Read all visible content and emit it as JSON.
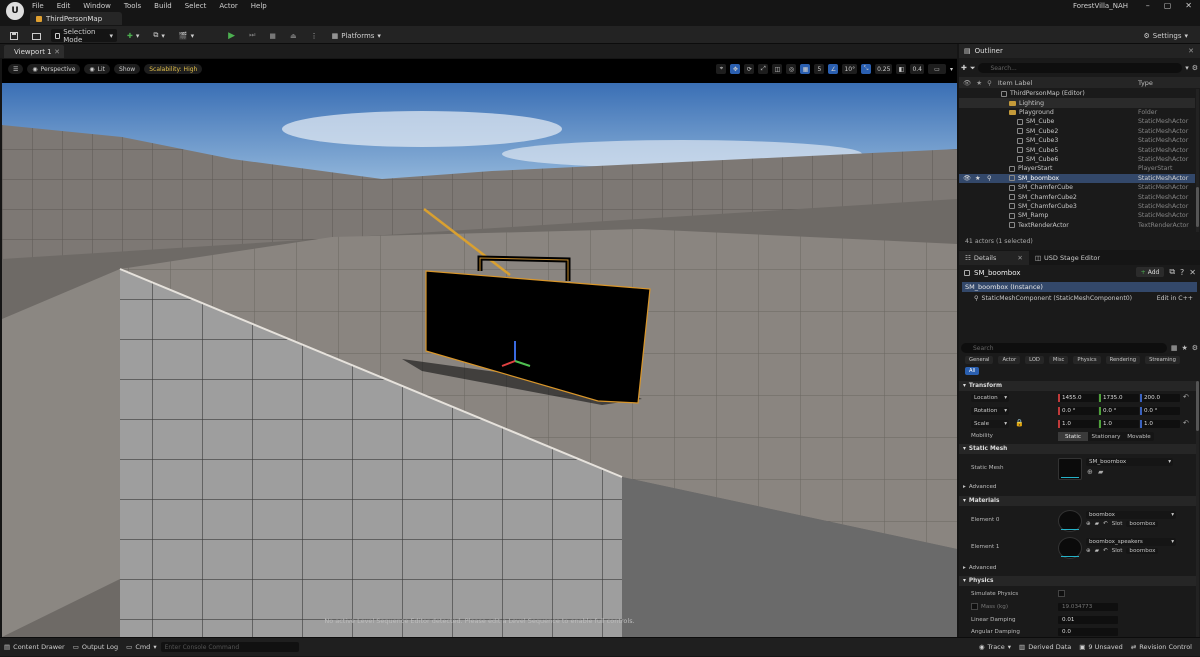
{
  "app": {
    "logo": "U",
    "project": "ForestVilla_NAH",
    "doc_tab": "ThirdPersonMap",
    "menus": [
      "File",
      "Edit",
      "Window",
      "Tools",
      "Build",
      "Select",
      "Actor",
      "Help"
    ],
    "win_min": "–",
    "win_max": "▢",
    "win_close": "✕"
  },
  "toolbar": {
    "selection_mode": "Selection Mode",
    "platforms": "Platforms",
    "settings": "Settings"
  },
  "viewport": {
    "tab_label": "Viewport 1",
    "perspective": "Perspective",
    "lit": "Lit",
    "show": "Show",
    "scalability": "Scalability: High",
    "grid_snap": "5",
    "angle_snap": "10°",
    "scale_snap": "0.25",
    "camera_speed": "0.4",
    "notice": "No active Level Sequence Editor detected. Please edit a Level Sequence to enable full controls."
  },
  "outliner": {
    "title": "Outliner",
    "search_placeholder": "Search...",
    "col_label": "Item Label",
    "col_type": "Type",
    "rows": [
      {
        "label": "ThirdPersonMap (Editor)",
        "type": ""
      },
      {
        "label": "Lighting",
        "type": ""
      },
      {
        "label": "Playground",
        "type": "Folder"
      },
      {
        "label": "SM_Cube",
        "type": "StaticMeshActor"
      },
      {
        "label": "SM_Cube2",
        "type": "StaticMeshActor"
      },
      {
        "label": "SM_Cube3",
        "type": "StaticMeshActor"
      },
      {
        "label": "SM_Cube5",
        "type": "StaticMeshActor"
      },
      {
        "label": "SM_Cube6",
        "type": "StaticMeshActor"
      },
      {
        "label": "PlayerStart",
        "type": "PlayerStart"
      },
      {
        "label": "SM_boombox",
        "type": "StaticMeshActor"
      },
      {
        "label": "SM_ChamferCube",
        "type": "StaticMeshActor"
      },
      {
        "label": "SM_ChamferCube2",
        "type": "StaticMeshActor"
      },
      {
        "label": "SM_ChamferCube3",
        "type": "StaticMeshActor"
      },
      {
        "label": "SM_Ramp",
        "type": "StaticMeshActor"
      },
      {
        "label": "TextRenderActor",
        "type": "TextRenderActor"
      }
    ],
    "count": "41 actors (1 selected)"
  },
  "details": {
    "tab_details": "Details",
    "tab_usd": "USD Stage Editor",
    "actor_name": "SM_boombox",
    "add_label": "Add",
    "instance_label": "SM_boombox (Instance)",
    "component_label": "StaticMeshComponent (StaticMeshComponent0)",
    "edit_cpp": "Edit in C++",
    "search_placeholder": "Search",
    "categories": [
      "General",
      "Actor",
      "LOD",
      "Misc",
      "Physics",
      "Rendering",
      "Streaming"
    ],
    "category_all": "All",
    "transform": {
      "section": "Transform",
      "location_label": "Location",
      "location": [
        "1455.0",
        "1735.0",
        "200.0"
      ],
      "rotation_label": "Rotation",
      "rotation": [
        "0.0 °",
        "0.0 °",
        "0.0 °"
      ],
      "scale_label": "Scale",
      "scale": [
        "1.0",
        "1.0",
        "1.0"
      ],
      "mobility_label": "Mobility",
      "mobility_options": [
        "Static",
        "Stationary",
        "Movable"
      ]
    },
    "static_mesh": {
      "section": "Static Mesh",
      "label": "Static Mesh",
      "value": "SM_boombox",
      "advanced": "Advanced"
    },
    "materials": {
      "section": "Materials",
      "element0_label": "Element 0",
      "element0_value": "boombox",
      "element0_slot": "boombox",
      "element1_label": "Element 1",
      "element1_value": "boombox_speakers",
      "element1_slot": "boombox",
      "slot_label": "Slot",
      "advanced": "Advanced"
    },
    "physics": {
      "section": "Physics",
      "simulate_label": "Simulate Physics",
      "mass_label": "Mass (kg)",
      "mass_value": "19.034773",
      "linear_label": "Linear Damping",
      "linear_value": "0.01",
      "angular_label": "Angular Damping",
      "angular_value": "0.0"
    }
  },
  "bottombar": {
    "content_drawer": "Content Drawer",
    "output_log": "Output Log",
    "cmd": "Cmd",
    "console_placeholder": "Enter Console Command",
    "trace": "Trace",
    "derived_data": "Derived Data",
    "unsaved": "9 Unsaved",
    "revision_control": "Revision Control"
  }
}
